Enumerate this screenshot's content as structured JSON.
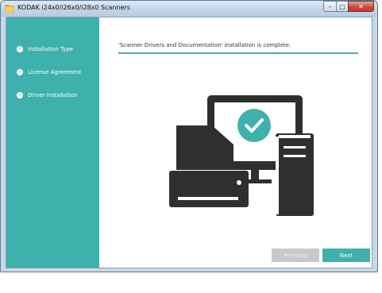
{
  "window": {
    "title": "KODAK i24x0/i26x0/i28x0 Scanners",
    "controls": {
      "minimize": "–",
      "maximize": "□",
      "close": "✕"
    }
  },
  "sidebar": {
    "steps": [
      {
        "label": "Installation Type",
        "status": "complete"
      },
      {
        "label": "License Agreement",
        "status": "complete"
      },
      {
        "label": "Driver Installation",
        "status": "complete"
      }
    ]
  },
  "main": {
    "message": "'Scanner Drivers and Documentation' installation is complete.",
    "illustration_icon": "computer-with-checkmark-icon"
  },
  "buttons": {
    "previous": {
      "label": "Previous",
      "enabled": false
    },
    "next": {
      "label": "Next",
      "enabled": true
    }
  },
  "colors": {
    "accent": "#3fb1ac",
    "illustration": "#2f2f2f",
    "disabled_button": "#c9c9c9"
  }
}
